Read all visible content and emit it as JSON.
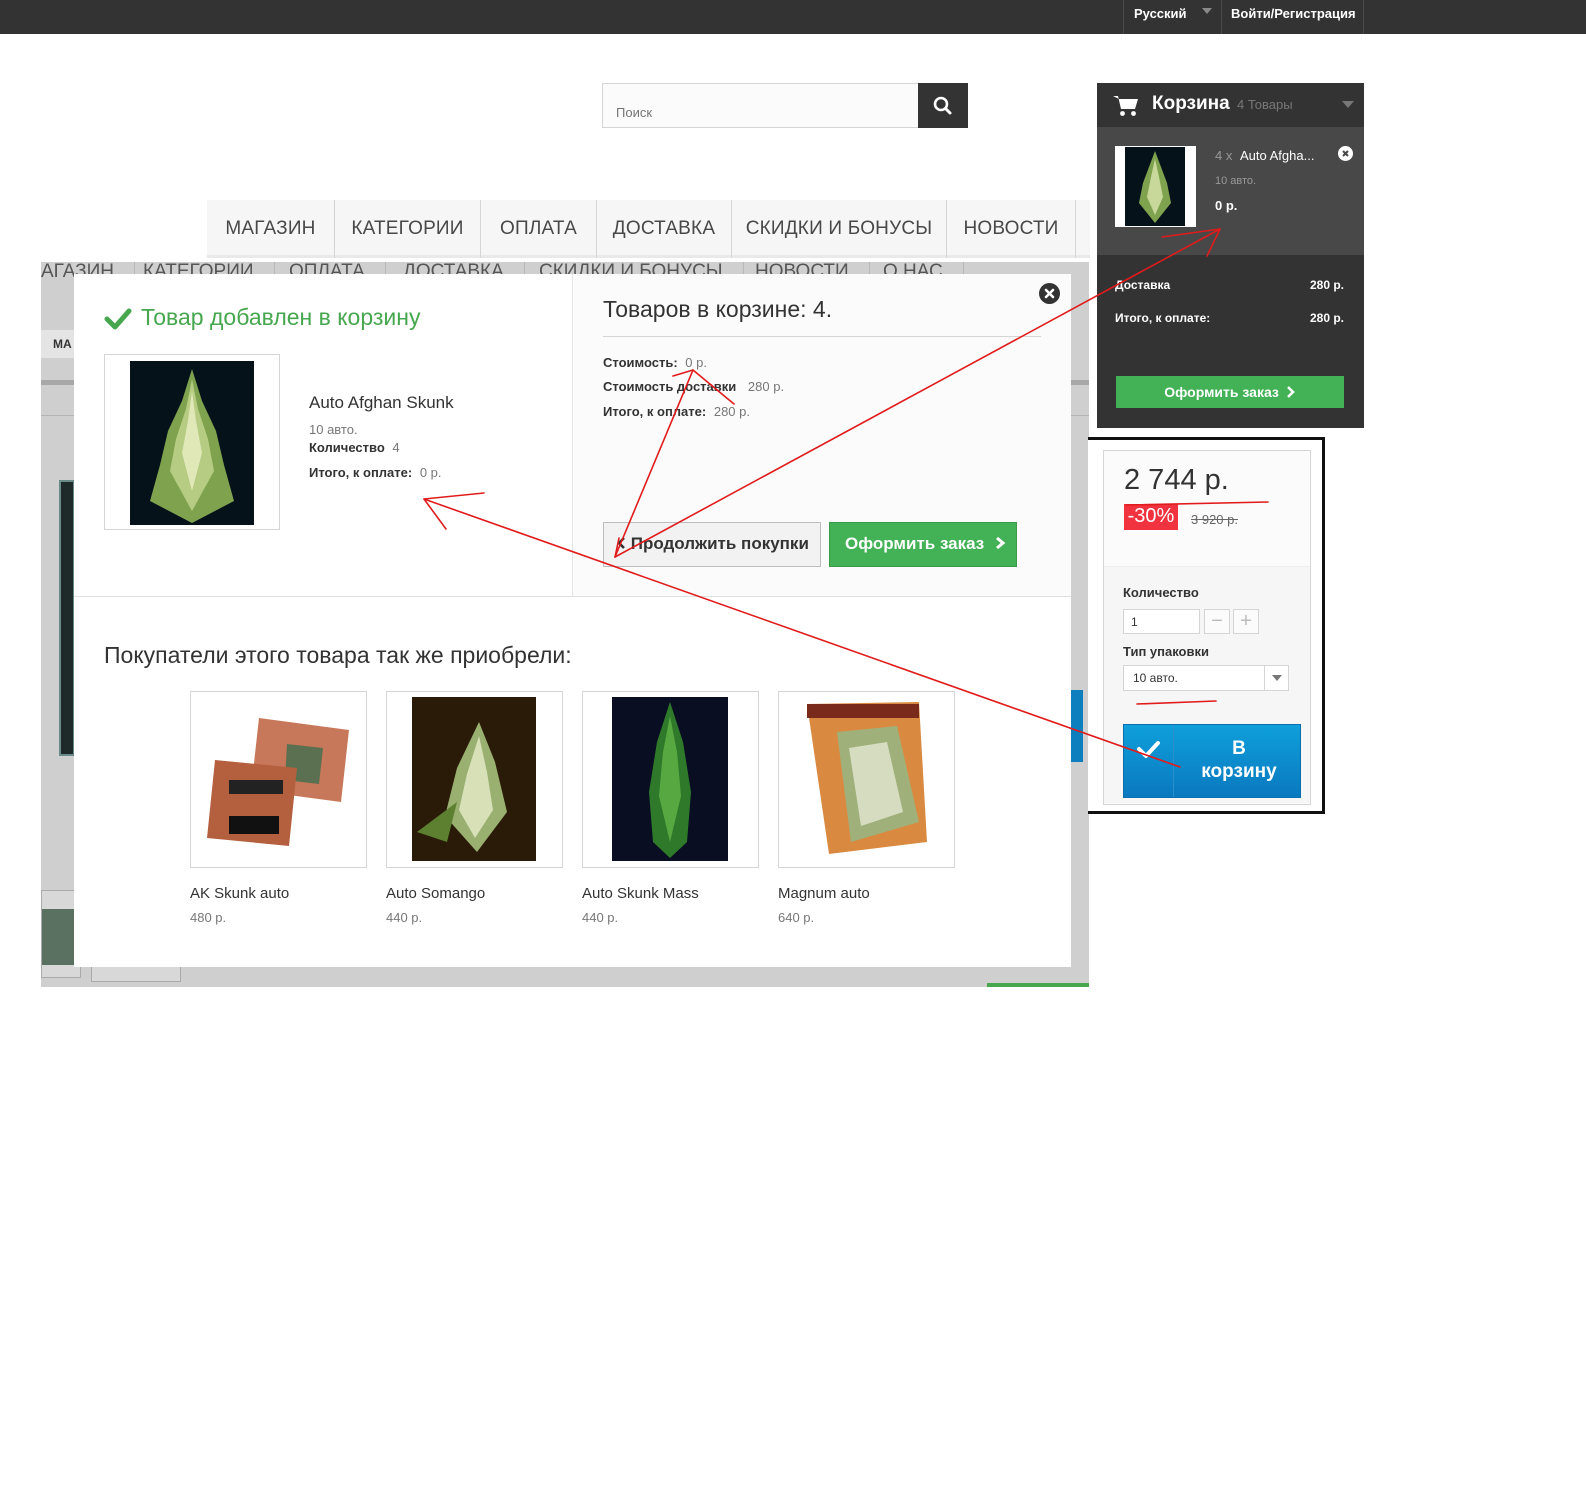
{
  "topbar": {
    "language": "Русский",
    "login": "Войти/Регистрация"
  },
  "search": {
    "placeholder": "Поиск"
  },
  "nav": {
    "items": [
      "МАГАЗИН",
      "КАТЕГОРИИ",
      "ОПЛАТА",
      "ДОСТАВКА",
      "СКИДКИ И БОНУСЫ",
      "НОВОСТИ"
    ]
  },
  "background": {
    "nav": [
      "АГАЗИН",
      "КАТЕГОРИИ",
      "ОПЛАТА",
      "ДОСТАВКА",
      "СКИДКИ И БОНУСЫ",
      "НОВОСТИ",
      "О НАС"
    ],
    "breadcrumb": "МА"
  },
  "popup": {
    "added_title": "Товар добавлен в корзину",
    "product": {
      "name": "Auto Afghan Skunk",
      "attr": "10 авто.",
      "qty_label": "Количество",
      "qty_value": "4",
      "total_label": "Итого, к оплате:",
      "total_value": "0 р."
    },
    "cart_count": "Товаров в корзине: 4.",
    "summary": {
      "cost_label": "Стоимость:",
      "cost_value": "0 р.",
      "shipping_label": "Стоимость доставки",
      "shipping_value": "280 р.",
      "total_label": "Итого, к оплате:",
      "total_value": "280 р."
    },
    "continue_label": "Продолжить покупки",
    "order_label": "Оформить заказ",
    "also_title": "Покупатели этого товара так же приобрели:",
    "related": [
      {
        "name": "AK Skunk auto",
        "price": "480 р."
      },
      {
        "name": "Auto Somango",
        "price": "440 р."
      },
      {
        "name": "Auto Skunk Mass",
        "price": "440 р."
      },
      {
        "name": "Magnum auto",
        "price": "640 р."
      }
    ]
  },
  "cart": {
    "title": "Корзина",
    "count": "4 Товары",
    "item": {
      "qty": "4 x",
      "name": "Auto Afgha...",
      "attr": "10 авто.",
      "price": "0 р."
    },
    "shipping_label": "Доставка",
    "shipping_value": "280 р.",
    "total_label": "Итого, к оплате:",
    "total_value": "280 р.",
    "order_label": "Оформить заказ"
  },
  "buybox": {
    "price": "2 744 р.",
    "discount": "-30%",
    "old_price": "3 920 р.",
    "qty_label": "Количество",
    "qty_value": "1",
    "pack_label": "Тип упаковки",
    "pack_value": "10 авто.",
    "to_cart_line1": "В",
    "to_cart_line2": "корзину"
  },
  "colors": {
    "accent_green": "#46a74e",
    "button_green": "#43b155",
    "cart_dark": "#333333",
    "blue_button": "#0a79bf",
    "discount_red": "#f13340",
    "annotation_red": "#e11b1b"
  }
}
